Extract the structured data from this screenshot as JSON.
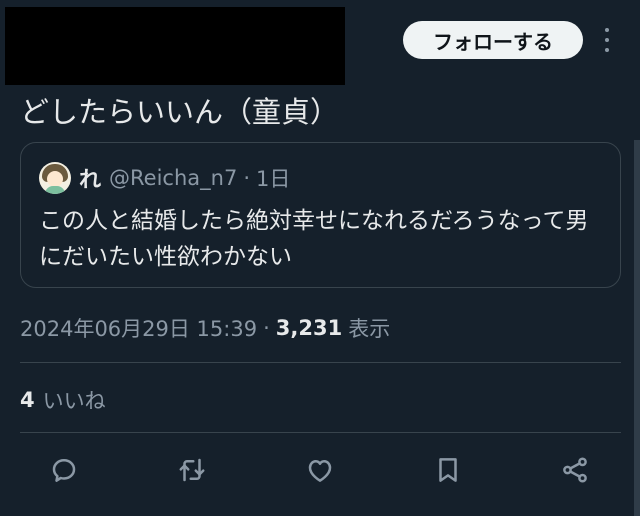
{
  "header": {
    "follow_label": "フォローする",
    "more_icon": "more-vertical-icon"
  },
  "tweet": {
    "text": "どしたらいいん（童貞）"
  },
  "quote": {
    "name": "れ",
    "handle": "@Reicha_n7",
    "separator": "·",
    "time": "1日",
    "body": "この人と結婚したら絶対幸せになれるだろうなって男にだいたい性欲わかない"
  },
  "meta": {
    "datetime": "2024年06月29日 15:39",
    "separator": "·",
    "views_count": "3,231",
    "views_label": "表示"
  },
  "likes": {
    "count": "4",
    "label": "いいね"
  },
  "actions": {
    "reply_icon": "reply-icon",
    "retweet_icon": "retweet-icon",
    "like_icon": "heart-icon",
    "bookmark_icon": "bookmark-icon",
    "share_icon": "share-icon"
  },
  "colors": {
    "background": "#15202b",
    "text": "#e7e9ea",
    "muted": "#8b98a5",
    "border": "#38444d",
    "button_bg": "#eff3f4"
  }
}
